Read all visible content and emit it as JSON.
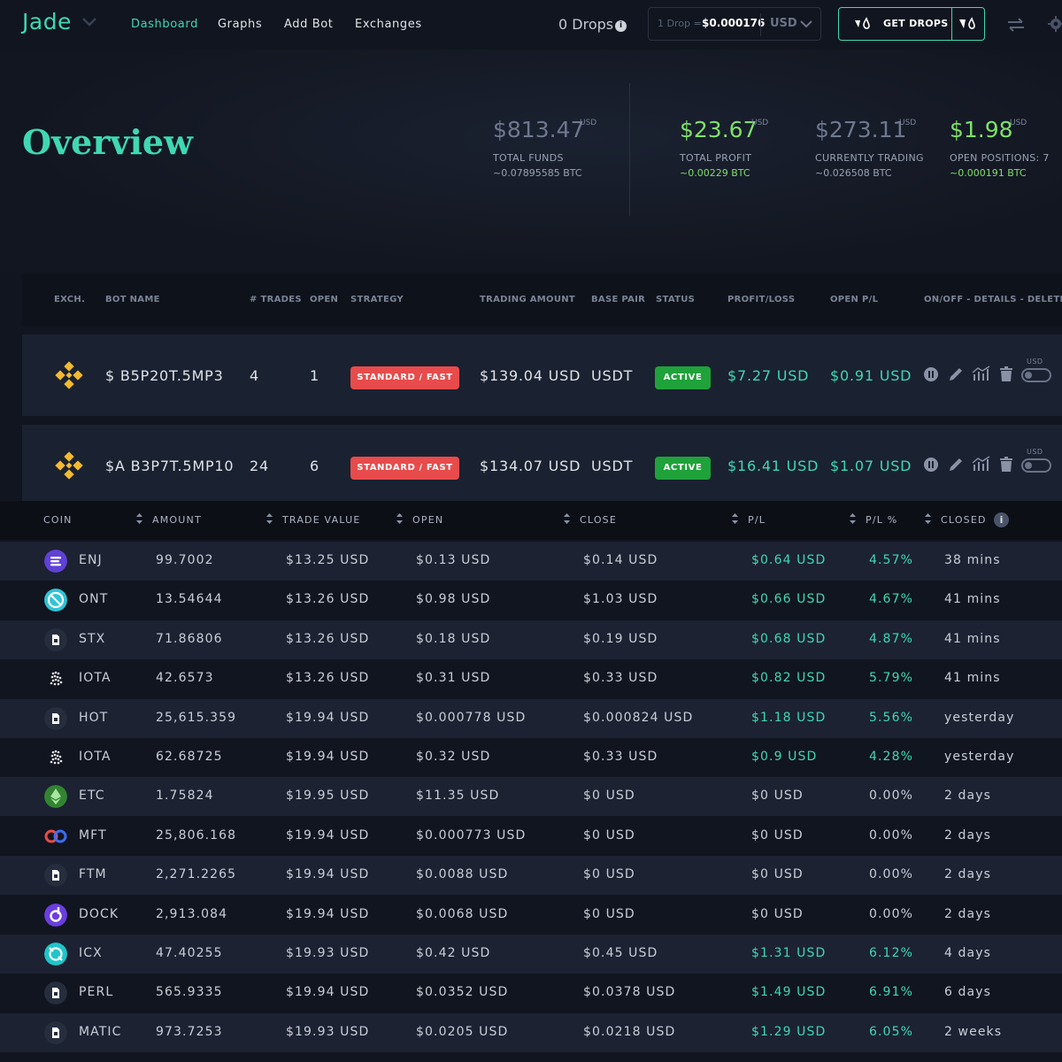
{
  "app": {
    "name": "Jade",
    "nav": [
      "Dashboard",
      "Graphs",
      "Add Bot",
      "Exchanges"
    ],
    "drops": "0 Drops",
    "drops_info": "i",
    "rate_label": "1 Drop =",
    "rate_value": "$0.000176",
    "currency": "USD",
    "get_drops": "GET DROPS"
  },
  "overview": {
    "title": "Overview",
    "stats": [
      {
        "value": "$813.47",
        "unit": "USD",
        "label": "TOTAL FUNDS",
        "btc": "~0.07895585 BTC"
      },
      {
        "value": "$23.67",
        "unit": "USD",
        "label": "TOTAL PROFIT",
        "btc": "~0.00229 BTC"
      },
      {
        "value": "$273.11",
        "unit": "USD",
        "label": "CURRENTLY TRADING",
        "btc": "~0.026508 BTC"
      },
      {
        "value": "$1.98",
        "unit": "USD",
        "label": "OPEN POSITIONS: 7",
        "btc": "~0.000191 BTC"
      }
    ]
  },
  "bots": {
    "headers": [
      "EXCH.",
      "BOT NAME",
      "# TRADES",
      "OPEN",
      "STRATEGY",
      "TRADING AMOUNT",
      "BASE PAIR",
      "STATUS",
      "PROFIT/LOSS",
      "OPEN P/L",
      "ON/OFF - DETAILS - DELETE"
    ],
    "rows": [
      {
        "name": "$ B5P20T.5MP3",
        "trades": "4",
        "open": "1",
        "strategy": "STANDARD / FAST",
        "amount": "$139.04 USD",
        "pair": "USDT",
        "status": "ACTIVE",
        "pl": "$7.27 USD",
        "open_pl": "$0.91 USD",
        "toggle_label": "USD"
      },
      {
        "name": "$A B3P7T.5MP10",
        "trades": "24",
        "open": "6",
        "strategy": "STANDARD / FAST",
        "amount": "$134.07 USD",
        "pair": "USDT",
        "status": "ACTIVE",
        "pl": "$16.41 USD",
        "open_pl": "$1.07 USD",
        "toggle_label": "USD"
      }
    ]
  },
  "trades": {
    "headers": [
      "COIN",
      "AMOUNT",
      "TRADE VALUE",
      "OPEN",
      "CLOSE",
      "P/L",
      "P/L %",
      "CLOSED"
    ],
    "closed_info": "i",
    "rows": [
      {
        "coin": "ENJ",
        "icon": "enj-icon",
        "amount": "99.7002",
        "value": "$13.25 USD",
        "open": "$0.13 USD",
        "close": "$0.14 USD",
        "pl": "$0.64 USD",
        "pct": "4.57%",
        "closed": "38 mins",
        "gain": true
      },
      {
        "coin": "ONT",
        "icon": "ont-icon",
        "amount": "13.54644",
        "value": "$13.26 USD",
        "open": "$0.98 USD",
        "close": "$1.03 USD",
        "pl": "$0.66 USD",
        "pct": "4.67%",
        "closed": "41 mins",
        "gain": true
      },
      {
        "coin": "STX",
        "icon": "file-icon",
        "amount": "71.86806",
        "value": "$13.26 USD",
        "open": "$0.18 USD",
        "close": "$0.19 USD",
        "pl": "$0.68 USD",
        "pct": "4.87%",
        "closed": "41 mins",
        "gain": true
      },
      {
        "coin": "IOTA",
        "icon": "iota-icon",
        "amount": "42.6573",
        "value": "$13.26 USD",
        "open": "$0.31 USD",
        "close": "$0.33 USD",
        "pl": "$0.82 USD",
        "pct": "5.79%",
        "closed": "41 mins",
        "gain": true
      },
      {
        "coin": "HOT",
        "icon": "file-icon",
        "amount": "25,615.359",
        "value": "$19.94 USD",
        "open": "$0.000778 USD",
        "close": "$0.000824 USD",
        "pl": "$1.18 USD",
        "pct": "5.56%",
        "closed": "yesterday",
        "gain": true
      },
      {
        "coin": "IOTA",
        "icon": "iota-icon",
        "amount": "62.68725",
        "value": "$19.94 USD",
        "open": "$0.32 USD",
        "close": "$0.33 USD",
        "pl": "$0.9 USD",
        "pct": "4.28%",
        "closed": "yesterday",
        "gain": true
      },
      {
        "coin": "ETC",
        "icon": "etc-icon",
        "amount": "1.75824",
        "value": "$19.95 USD",
        "open": "$11.35 USD",
        "close": "$0 USD",
        "pl": "$0 USD",
        "pct": "0.00%",
        "closed": "2 days",
        "gain": false
      },
      {
        "coin": "MFT",
        "icon": "mft-icon",
        "amount": "25,806.168",
        "value": "$19.94 USD",
        "open": "$0.000773 USD",
        "close": "$0 USD",
        "pl": "$0 USD",
        "pct": "0.00%",
        "closed": "2 days",
        "gain": false
      },
      {
        "coin": "FTM",
        "icon": "file-icon",
        "amount": "2,271.2265",
        "value": "$19.94 USD",
        "open": "$0.0088 USD",
        "close": "$0 USD",
        "pl": "$0 USD",
        "pct": "0.00%",
        "closed": "2 days",
        "gain": false
      },
      {
        "coin": "DOCK",
        "icon": "dock-icon",
        "amount": "2,913.084",
        "value": "$19.94 USD",
        "open": "$0.0068 USD",
        "close": "$0 USD",
        "pl": "$0 USD",
        "pct": "0.00%",
        "closed": "2 days",
        "gain": false
      },
      {
        "coin": "ICX",
        "icon": "icx-icon",
        "amount": "47.40255",
        "value": "$19.93 USD",
        "open": "$0.42 USD",
        "close": "$0.45 USD",
        "pl": "$1.31 USD",
        "pct": "6.12%",
        "closed": "4 days",
        "gain": true
      },
      {
        "coin": "PERL",
        "icon": "file-icon",
        "amount": "565.9335",
        "value": "$19.94 USD",
        "open": "$0.0352 USD",
        "close": "$0.0378 USD",
        "pl": "$1.49 USD",
        "pct": "6.91%",
        "closed": "6 days",
        "gain": true
      },
      {
        "coin": "MATIC",
        "icon": "file-icon",
        "amount": "973.7253",
        "value": "$19.93 USD",
        "open": "$0.0205 USD",
        "close": "$0.0218 USD",
        "pl": "$1.29 USD",
        "pct": "6.05%",
        "closed": "2 weeks",
        "gain": true
      }
    ]
  },
  "colors": {
    "accent": "#3fd8b3",
    "profit": "#7fe06a",
    "danger": "#e84b4b",
    "active": "#1fa23a",
    "background": "#11151f"
  }
}
